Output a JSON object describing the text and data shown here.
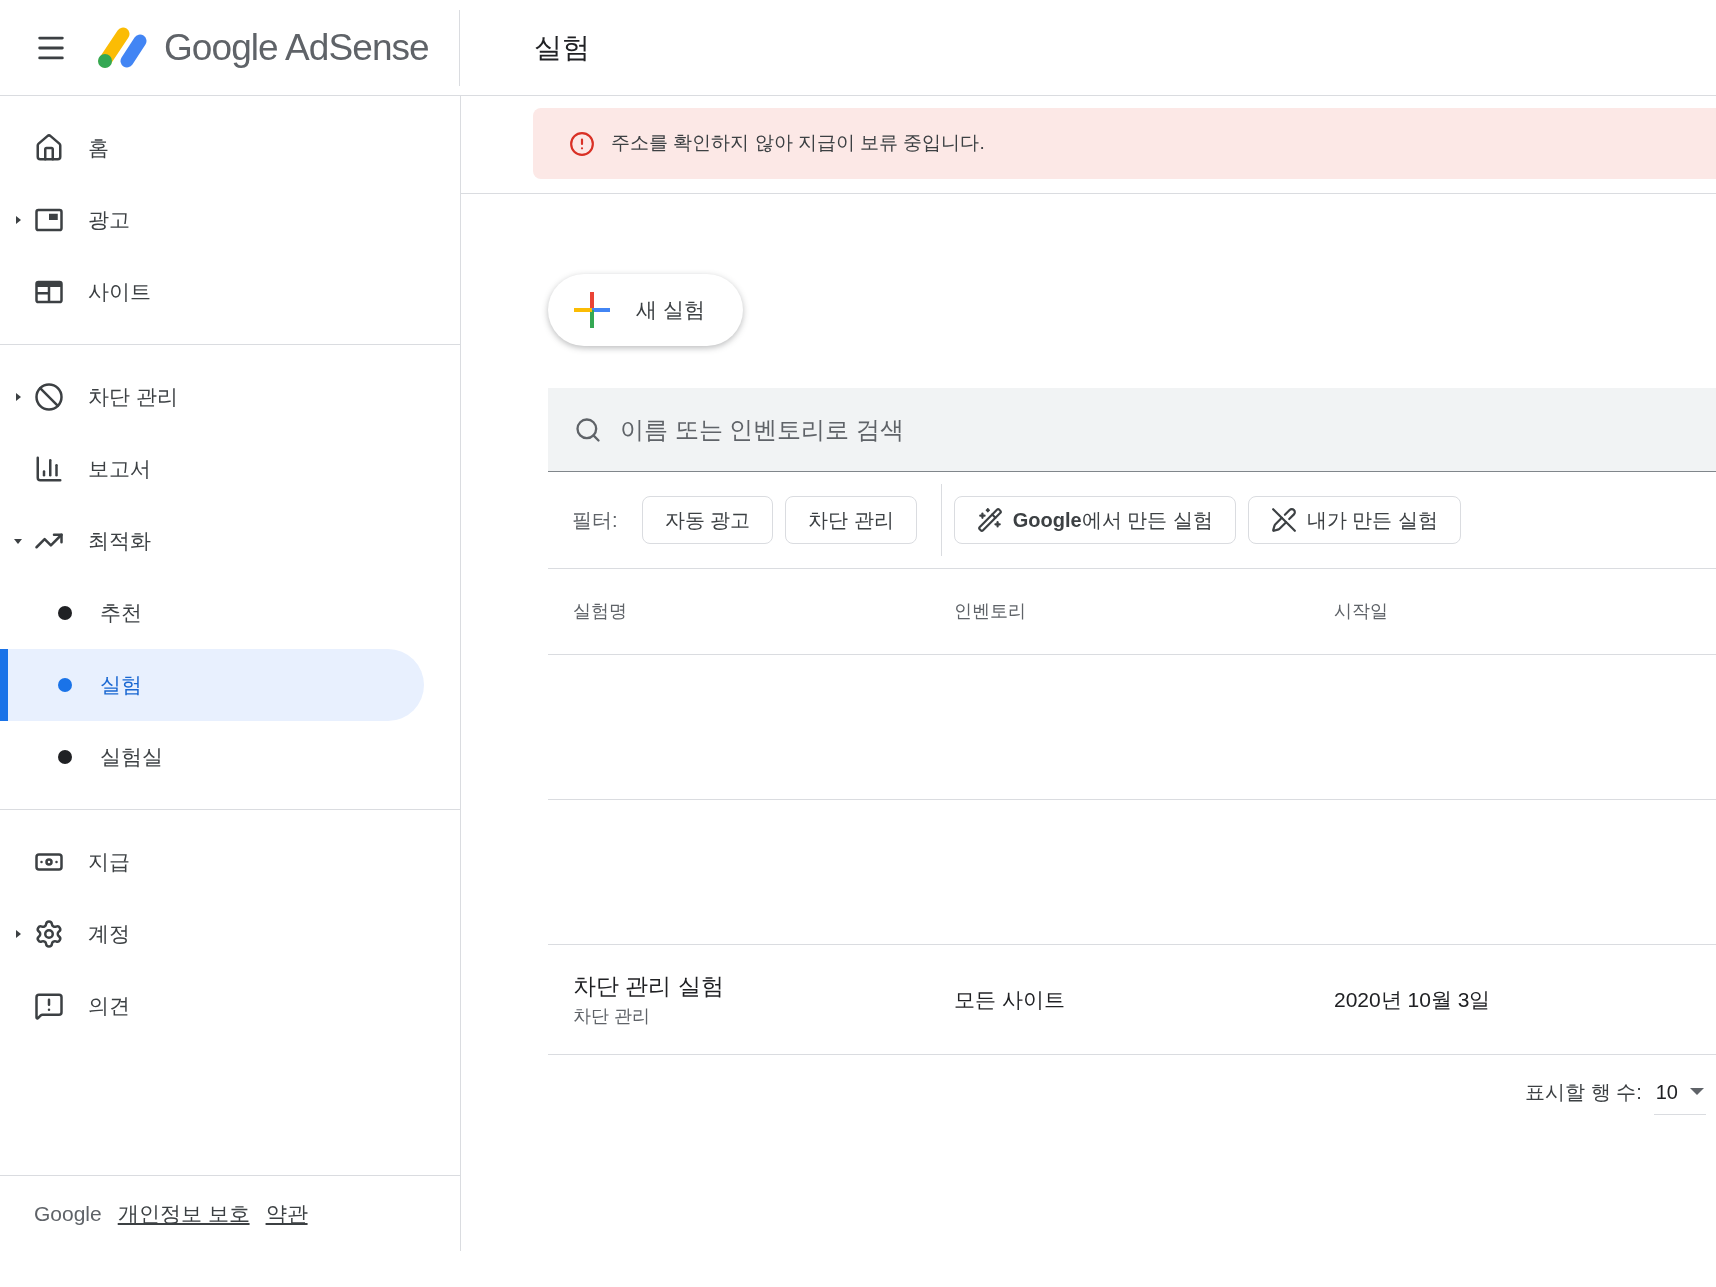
{
  "header": {
    "product": "Google AdSense",
    "page_title": "실험"
  },
  "sidebar": {
    "groups": [
      [
        {
          "label": "홈",
          "selected": false
        },
        {
          "label": "광고",
          "selected": false,
          "expanded": false
        },
        {
          "label": "사이트",
          "selected": false
        }
      ],
      [
        {
          "label": "차단 관리",
          "selected": false,
          "expanded": false
        },
        {
          "label": "보고서",
          "selected": false
        },
        {
          "label": "최적화",
          "selected": false,
          "expanded": true,
          "children": [
            {
              "label": "추천",
              "selected": false
            },
            {
              "label": "실험",
              "selected": true
            },
            {
              "label": "실험실",
              "selected": false
            }
          ]
        }
      ],
      [
        {
          "label": "지급",
          "selected": false
        },
        {
          "label": "계정",
          "selected": false,
          "expanded": false
        },
        {
          "label": "의견",
          "selected": false
        }
      ]
    ],
    "footer": {
      "brand": "Google",
      "links": [
        "개인정보 보호",
        "약관"
      ]
    }
  },
  "alert": {
    "text": "주소를 확인하지 않아 지급이 보류 중입니다."
  },
  "new_button": {
    "label": "새 실험"
  },
  "search": {
    "placeholder": "이름 또는 인벤토리로 검색"
  },
  "filters": {
    "label": "필터:",
    "chips": [
      {
        "kind": "plain",
        "label": "자동 광고"
      },
      {
        "kind": "plain",
        "label": "차단 관리"
      },
      {
        "kind": "google",
        "brand": "Google",
        "label": "에서 만든 실험"
      },
      {
        "kind": "mine",
        "label": "내가 만든 실험"
      }
    ]
  },
  "table": {
    "columns": [
      "실험명",
      "인벤토리",
      "시작일"
    ],
    "rows": [
      {
        "name": "차단 관리 실험",
        "type": "차단 관리",
        "inventory": "모든 사이트",
        "start": "2020년 10월 3일"
      }
    ]
  },
  "pagination": {
    "label": "표시할 행 수:",
    "value": "10"
  }
}
